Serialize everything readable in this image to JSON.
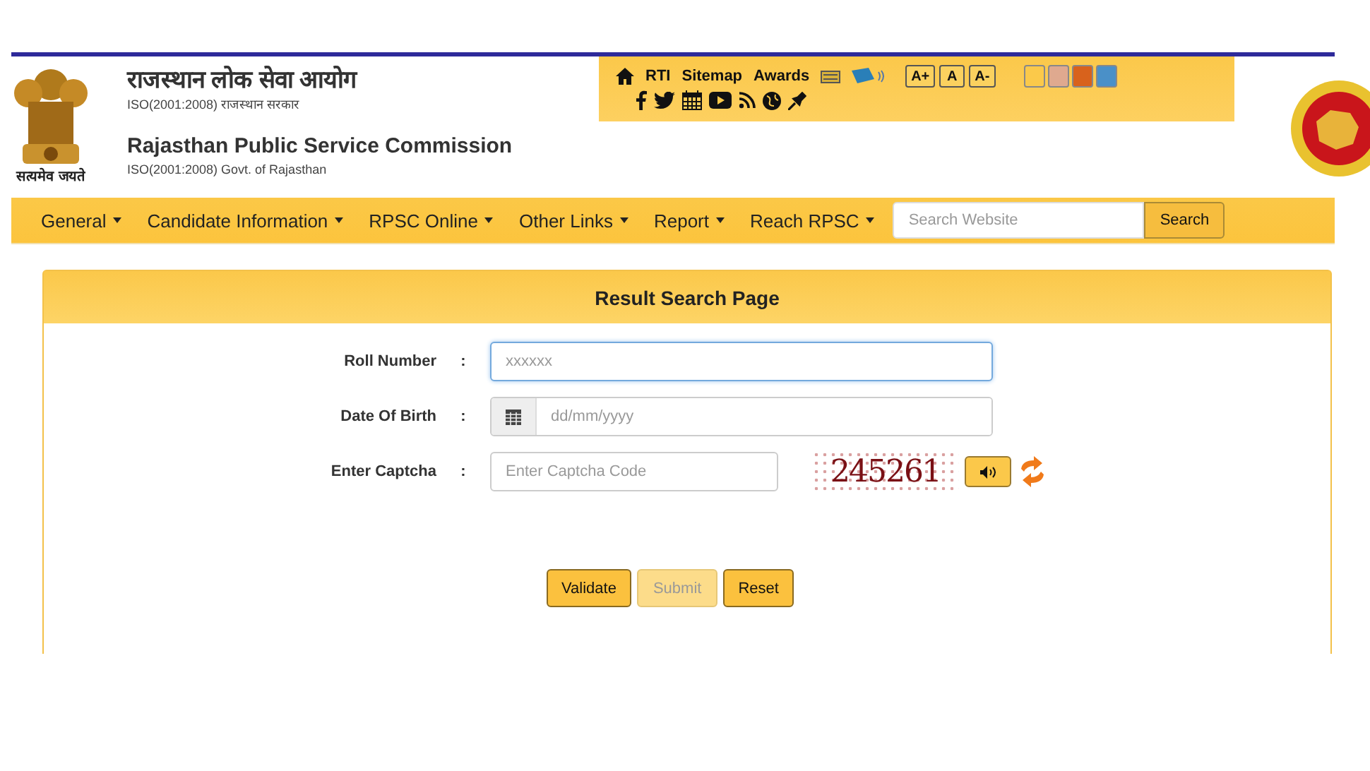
{
  "header": {
    "title_hi": "राजस्थान लोक सेवा आयोग",
    "subtitle_hi": "ISO(2001:2008) राजस्थान सरकार",
    "title_en": "Rajasthan Public Service Commission",
    "subtitle_en": "ISO(2001:2008) Govt. of Rajasthan",
    "emblem_motto": "सत्यमेव जयते"
  },
  "toolbar": {
    "links": [
      "RTI",
      "Sitemap",
      "Awards"
    ],
    "font_buttons": [
      "A+",
      "A",
      "A-"
    ],
    "themes": [
      {
        "color": "#fbc94a"
      },
      {
        "color": "#dfa98f"
      },
      {
        "color": "#d8621c"
      },
      {
        "color": "#4a90c8"
      }
    ]
  },
  "nav": {
    "items": [
      "General",
      "Candidate Information",
      "RPSC Online",
      "Other Links",
      "Report",
      "Reach RPSC"
    ],
    "search_placeholder": "Search Website",
    "search_button": "Search"
  },
  "form": {
    "title": "Result Search Page",
    "fields": [
      {
        "kind": "text",
        "label": "Roll Number",
        "separator": ":",
        "placeholder": "xxxxxx",
        "focused": true
      },
      {
        "kind": "date",
        "label": "Date Of Birth",
        "separator": ":",
        "placeholder": "dd/mm/yyyy",
        "focused": false
      },
      {
        "kind": "captcha",
        "label": "Enter Captcha",
        "separator": ":",
        "placeholder": "Enter Captcha Code",
        "focused": false,
        "captcha": "245261"
      }
    ],
    "buttons": [
      {
        "label": "Validate",
        "disabled": false
      },
      {
        "label": "Submit",
        "disabled": true
      },
      {
        "label": "Reset",
        "disabled": false
      }
    ]
  }
}
